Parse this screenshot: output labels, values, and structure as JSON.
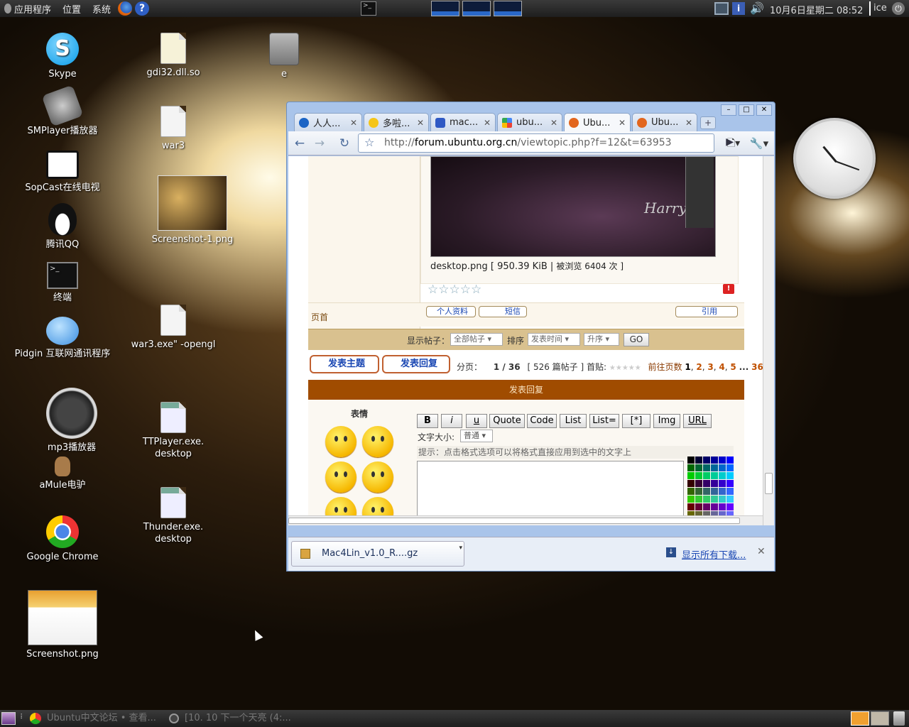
{
  "top_panel": {
    "menus": [
      "应用程序",
      "位置",
      "系统"
    ],
    "clock_text": "10月6日星期二 08:52",
    "user": "ice"
  },
  "desktop_icons": [
    {
      "label": "Skype",
      "icon": "skype-icon"
    },
    {
      "label": "SMPlayer播放器",
      "icon": "smplayer-icon"
    },
    {
      "label": "SopCast在线电视",
      "icon": "tv-icon"
    },
    {
      "label": "腾讯QQ",
      "icon": "qq-penguin-icon"
    },
    {
      "label": "终端",
      "icon": "terminal-icon"
    },
    {
      "label": "Pidgin 互联网通讯程序",
      "icon": "pidgin-icon"
    },
    {
      "label": "mp3播放器",
      "icon": "mp3-player-icon"
    },
    {
      "label": "aMule电驴",
      "icon": "amule-icon"
    },
    {
      "label": "Google Chrome",
      "icon": "chrome-icon"
    },
    {
      "label": "Screenshot.png",
      "icon": "screenshot-thumb"
    },
    {
      "label": "gdi32.dll.so",
      "icon": "script-file-icon"
    },
    {
      "label": "war3",
      "icon": "file-icon"
    },
    {
      "label": "Screenshot-1.png",
      "icon": "screenshot-thumb"
    },
    {
      "label": "war3.exe\" -opengl",
      "icon": "file-icon"
    },
    {
      "label": "TTPlayer.exe.",
      "label2": "desktop",
      "icon": "desktop-file-icon"
    },
    {
      "label": "Thunder.exe.",
      "label2": "desktop",
      "icon": "desktop-file-icon"
    },
    {
      "label": "e",
      "icon": "drive-icon"
    }
  ],
  "browser": {
    "tabs": [
      {
        "title": "人人..."
      },
      {
        "title": "多啦..."
      },
      {
        "title": "mac..."
      },
      {
        "title": "ubu..."
      },
      {
        "title": "Ubu..."
      },
      {
        "title": "Ubu..."
      }
    ],
    "url_prefix": "http://",
    "url_host": "forum.ubuntu.org.cn",
    "url_path": "/viewtopic.php?f=12&t=63953",
    "image_caption_file": "desktop.png [ 950.39 KiB | ",
    "image_caption_views": "被浏览 6404 次 ]",
    "page_top": "页首",
    "profile_btn": "个人资料",
    "pm_btn": "短信",
    "quote_btn": "引用",
    "show_posts_label": "显示帖子：",
    "show_posts_value": "全部帖子",
    "sort_label": "排序",
    "sort_value": "发表时间",
    "order_value": "升序",
    "go_btn": "GO",
    "new_topic_btn": "发表主题",
    "reply_btn": "发表回复",
    "pagination_label": "分页：",
    "pagination_value": "1 / 36",
    "posts_count": "[ 526 篇帖子 ]",
    "first_post_label": "首贴:",
    "goto_label": "前往页数",
    "pages": [
      "1",
      "2",
      "3",
      "4",
      "5"
    ],
    "ellipsis": "...",
    "last_page": "36",
    "reply_header": "发表回复",
    "smilies_label": "表情",
    "format_buttons": [
      "B",
      "i",
      "u",
      "Quote",
      "Code",
      "List",
      "List=",
      "[*]",
      "Img",
      "URL"
    ],
    "font_size_label": "文字大小:",
    "font_size_value": "普通",
    "hint": "提示：点击格式选项可以将格式直接应用到选中的文字上",
    "download_file": "Mac4Lin_v1.0_R....gz",
    "show_all_downloads": "显示所有下载..."
  },
  "taskbar": [
    {
      "title": "Ubuntu中文论坛 • 查看..."
    },
    {
      "title": "[10. 10  下一个天亮 (4:..."
    }
  ],
  "colors": {
    "forum_orange": "#a04c00",
    "forum_tan": "#d9c18f",
    "link_blue": "#1a47b3"
  }
}
